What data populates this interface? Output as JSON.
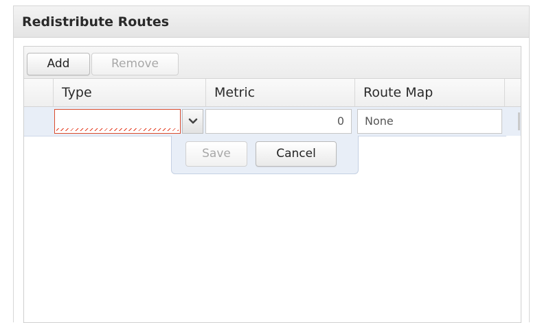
{
  "panel": {
    "title": "Redistribute Routes"
  },
  "toolbar": {
    "add_label": "Add",
    "remove_label": "Remove"
  },
  "columns": {
    "type": "Type",
    "metric": "Metric",
    "route_map": "Route Map"
  },
  "edit_row": {
    "type_value": "",
    "metric_value": "0",
    "route_map_value": "None"
  },
  "row_editor": {
    "save_label": "Save",
    "cancel_label": "Cancel"
  },
  "icons": {
    "dropdown": "chevron-down-icon"
  },
  "colors": {
    "invalid": "#d94a2b",
    "row_highlight": "#e8eef7"
  }
}
